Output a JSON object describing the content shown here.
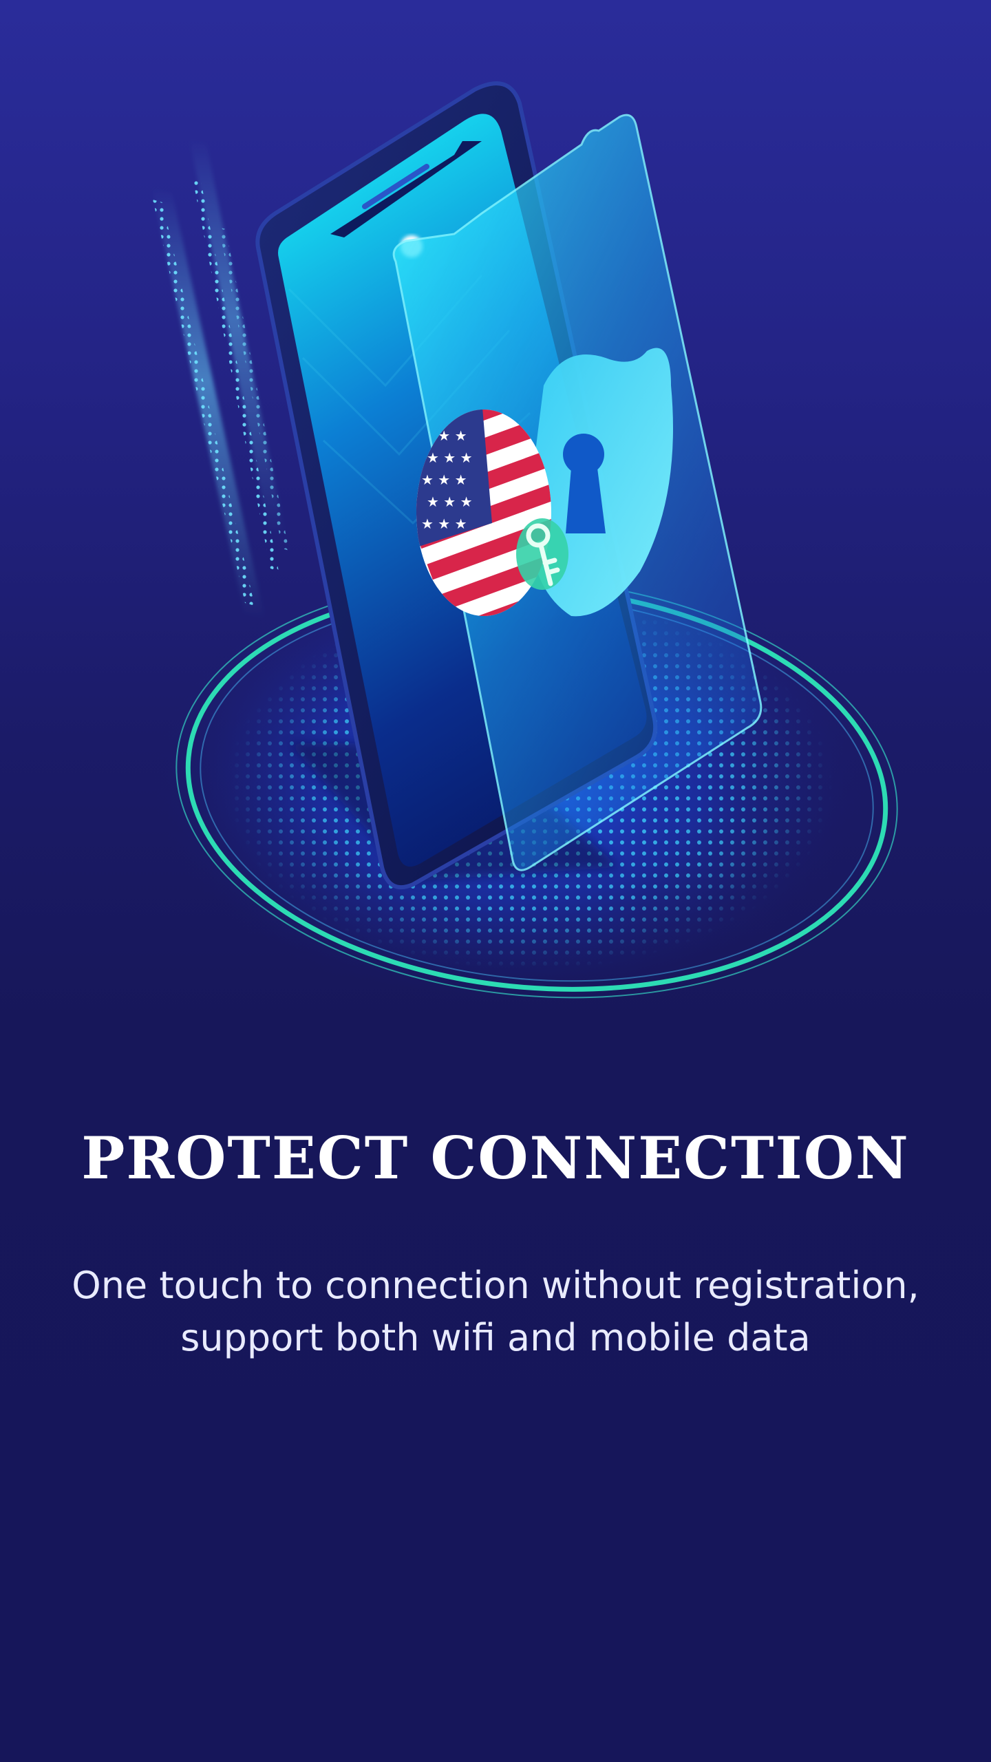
{
  "onboarding": {
    "title": "PROTECT CONNECTION",
    "description_line1": "One touch to connection without registration,",
    "description_line2": "support both wifi and mobile data"
  },
  "illustration": {
    "icons": [
      "phone-icon",
      "us-flag-icon",
      "shield-icon",
      "keyhole-icon",
      "key-icon"
    ]
  },
  "colors": {
    "background_top": "#2a2c9a",
    "background_bottom": "#16165a",
    "accent_cyan": "#26e7ff",
    "accent_teal": "#2ee6b8",
    "text": "#ffffff"
  }
}
